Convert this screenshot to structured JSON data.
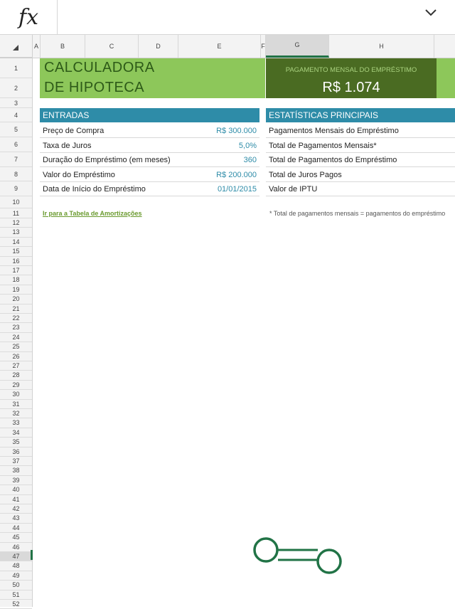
{
  "formula_bar": {
    "fx_label": "fx",
    "expand_icon": "chevron-down-icon"
  },
  "columns": [
    "A",
    "B",
    "C",
    "D",
    "E",
    "F",
    "G",
    "H"
  ],
  "active_column": "G",
  "rows": [
    "1",
    "2",
    "3",
    "4",
    "5",
    "6",
    "7",
    "8",
    "9",
    "10",
    "11",
    "12",
    "13",
    "14",
    "15",
    "16",
    "17",
    "18",
    "19",
    "20",
    "21",
    "22",
    "23",
    "24",
    "25",
    "26",
    "27",
    "28",
    "29",
    "30",
    "31",
    "32",
    "33",
    "34",
    "35",
    "36",
    "37",
    "38",
    "39",
    "40",
    "41",
    "42",
    "43",
    "44",
    "45",
    "46",
    "47",
    "48",
    "49",
    "50",
    "51",
    "52"
  ],
  "active_row": "47",
  "title": {
    "line1": "CALCULADORA",
    "line2": "DE HIPOTECA"
  },
  "payment": {
    "label": "PAGAMENTO MENSAL DO EMPRÉSTIMO",
    "value": "R$ 1.074"
  },
  "inputs": {
    "header": "ENTRADAS",
    "items": [
      {
        "label": "Preço de Compra",
        "value": "R$ 300.000"
      },
      {
        "label": "Taxa de Juros",
        "value": "5,0%"
      },
      {
        "label": "Duração do Empréstimo (em meses)",
        "value": "360"
      },
      {
        "label": "Valor do Empréstimo",
        "value": "R$ 200.000"
      },
      {
        "label": "Data de Início do Empréstimo",
        "value": "01/01/2015"
      }
    ]
  },
  "stats": {
    "header": "ESTATÍSTICAS PRINCIPAIS",
    "items": [
      {
        "label": "Pagamentos Mensais do Empréstimo"
      },
      {
        "label": "Total de Pagamentos Mensais*"
      },
      {
        "label": "Total de Pagamentos do Empréstimo"
      },
      {
        "label": "Total de Juros Pagos"
      },
      {
        "label": "Valor de IPTU"
      }
    ]
  },
  "link_text": "Ir para a Tabela de Amortizações",
  "footnote": "* Total de pagamentos mensais = pagamentos do empréstimo",
  "colors": {
    "green_title": "#8dc75a",
    "dark_green": "#4a6b22",
    "teal": "#2e8ca8",
    "excel_green": "#217346"
  }
}
